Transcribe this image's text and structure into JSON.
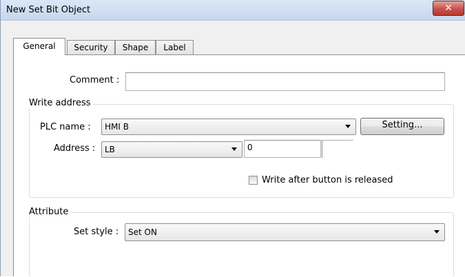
{
  "window": {
    "title": "New  Set Bit Object",
    "close_glyph": "✕"
  },
  "tabs": [
    {
      "label": "General",
      "active": true
    },
    {
      "label": "Security",
      "active": false
    },
    {
      "label": "Shape",
      "active": false
    },
    {
      "label": "Label",
      "active": false
    }
  ],
  "general": {
    "comment_label": "Comment :",
    "comment_value": "",
    "write_address": {
      "group_title": "Write address",
      "plc_name_label": "PLC name :",
      "plc_name_value": "HMI B",
      "setting_button": "Setting...",
      "address_label": "Address :",
      "address_device": "LB",
      "address_value": "0",
      "write_after_release_label": "Write after button is released",
      "write_after_release_checked": false
    },
    "attribute": {
      "group_title": "Attribute",
      "set_style_label": "Set style :",
      "set_style_value": "Set ON"
    }
  },
  "colors": {
    "titlebar": "#c6d7ee",
    "close_button": "#c75050",
    "panel": "#ffffff"
  }
}
